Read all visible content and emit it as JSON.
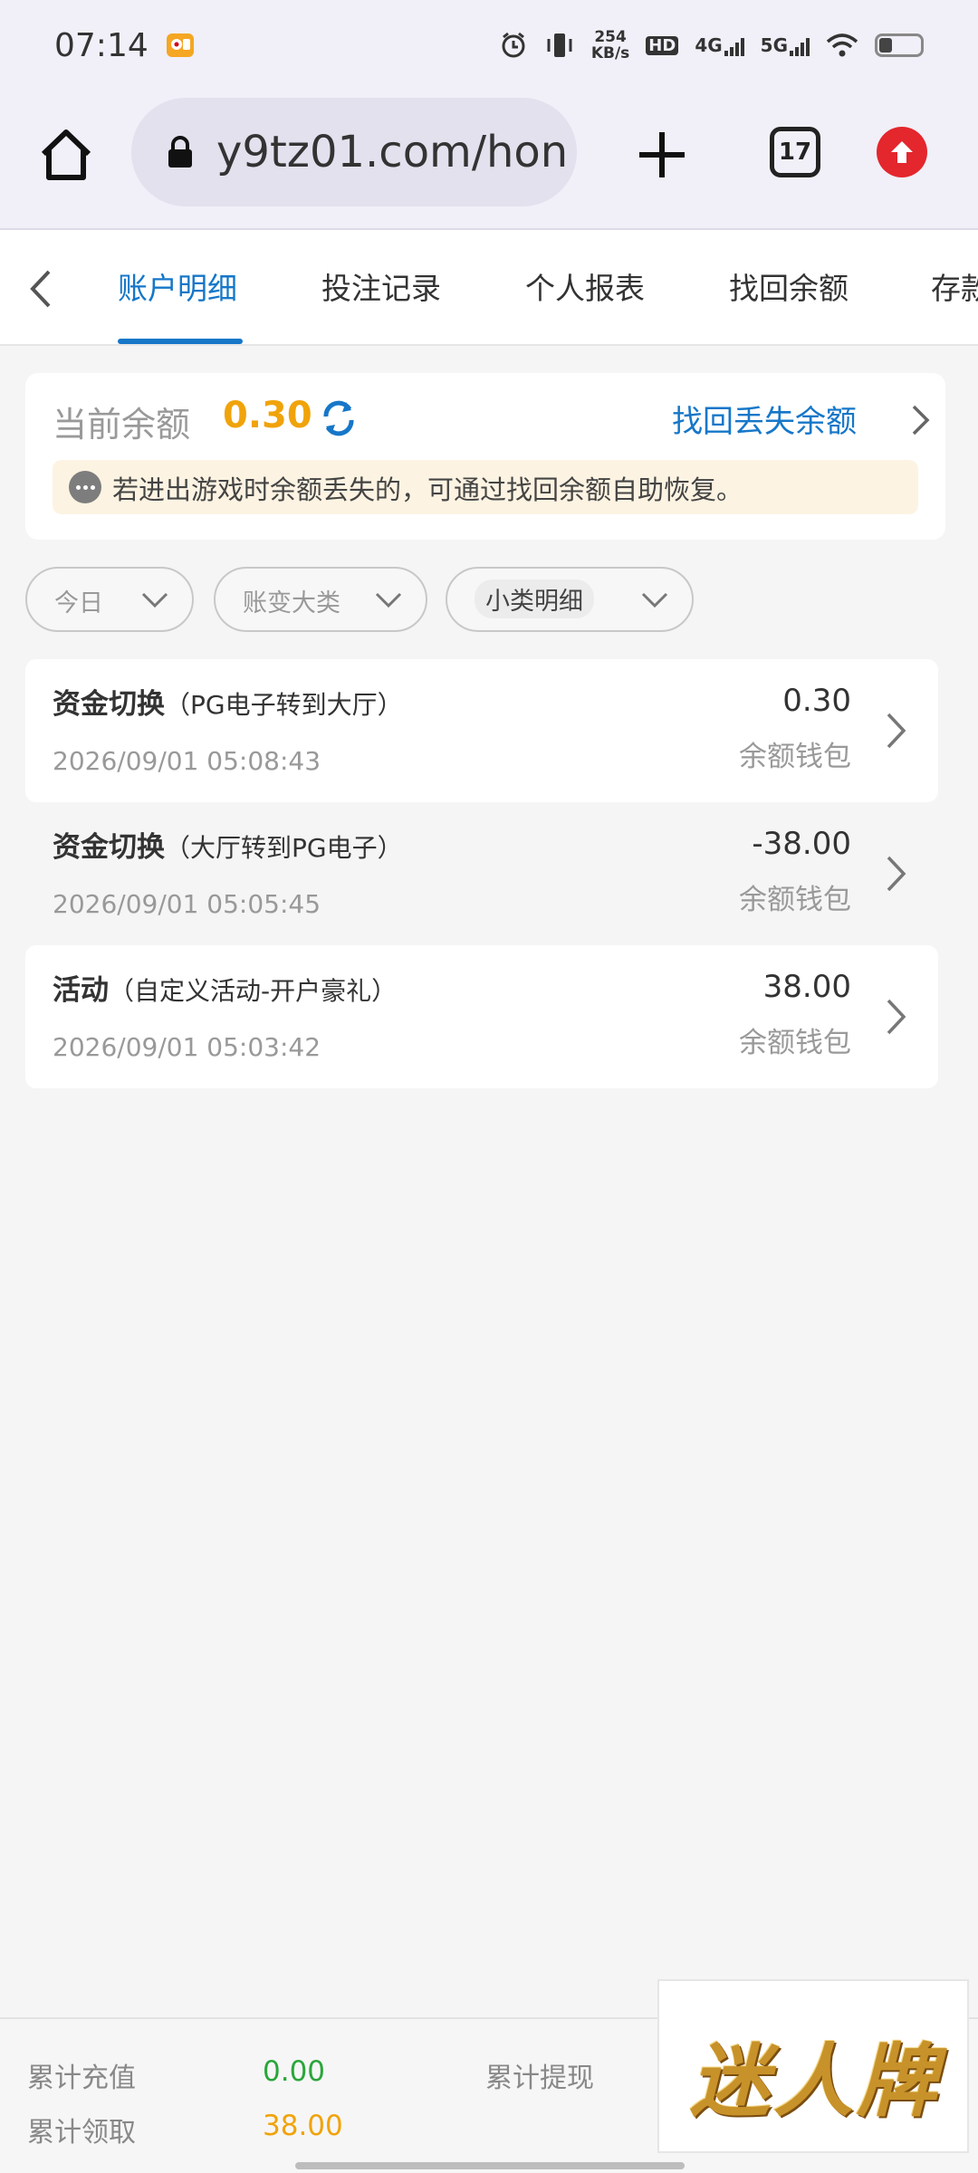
{
  "status_bar": {
    "time": "07:14",
    "rate_value": "254",
    "rate_unit": "KB/s",
    "hd_label": "HD",
    "net_4g": "4G",
    "net_5g": "5G"
  },
  "browser": {
    "url": "y9tz01.com/hon",
    "tab_count": "17"
  },
  "nav_tabs": {
    "items": [
      {
        "label": "账户明细"
      },
      {
        "label": "投注记录"
      },
      {
        "label": "个人报表"
      },
      {
        "label": "找回余额"
      },
      {
        "label": "存款"
      }
    ]
  },
  "balance": {
    "label": "当前余额",
    "value": "0.30",
    "recover_link": "找回丢失余额",
    "notice": "若进出游戏时余额丢失的，可通过找回余额自助恢复。"
  },
  "filters": {
    "date": "今日",
    "category": "账变大类",
    "subcategory": "小类明细"
  },
  "records": [
    {
      "title": "资金切换",
      "detail": "（PG电子转到大厅）",
      "time": "2026/09/01 05:08:43",
      "amount": "0.30",
      "wallet": "余额钱包"
    },
    {
      "title": "资金切换",
      "detail": "（大厅转到PG电子）",
      "time": "2026/09/01 05:05:45",
      "amount": "-38.00",
      "wallet": "余额钱包"
    },
    {
      "title": "活动",
      "detail": "（自定义活动-开户豪礼）",
      "time": "2026/09/01 05:03:42",
      "amount": "38.00",
      "wallet": "余额钱包"
    }
  ],
  "footer": {
    "recharge_label": "累计充值",
    "recharge_value": "0.00",
    "withdraw_label": "累计提现",
    "claim_label": "累计领取",
    "claim_value": "38.00",
    "brand": "迷人牌"
  },
  "colors": {
    "accent_blue": "#1677c8",
    "balance_gold": "#f0a30a",
    "green_value": "#2aa63a",
    "update_red": "#e4262d"
  }
}
